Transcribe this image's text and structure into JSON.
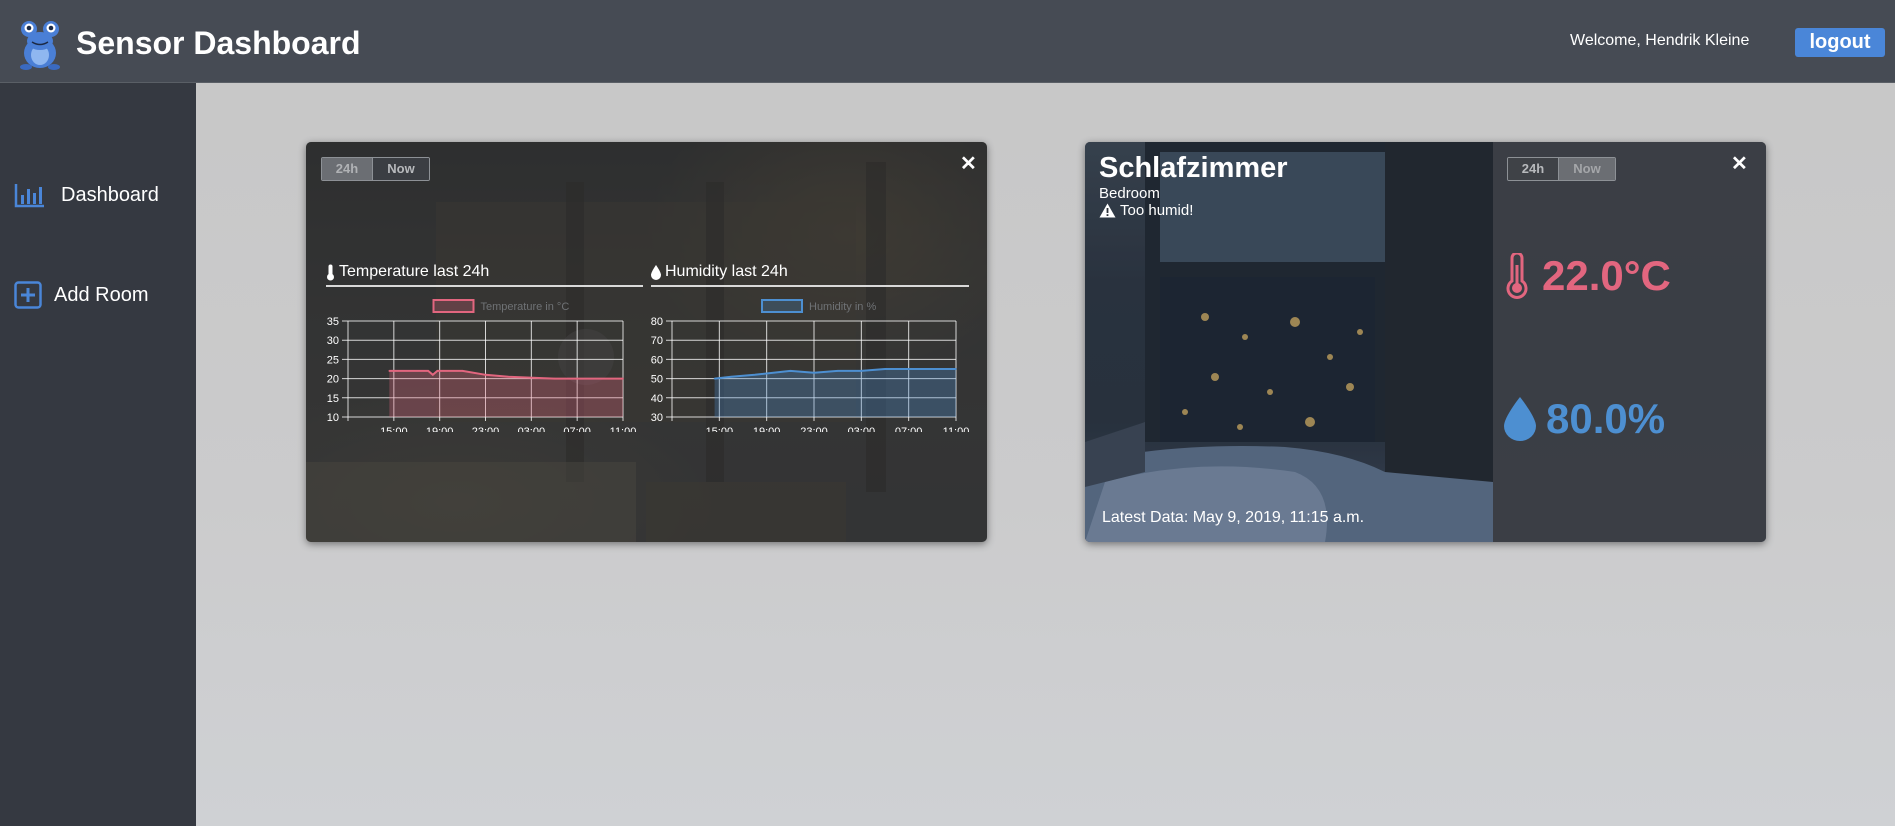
{
  "header": {
    "app_title": "Sensor Dashboard",
    "welcome": "Welcome, Hendrik Kleine",
    "logout_label": "logout",
    "logo_icon": "frog-logo-icon"
  },
  "sidebar": {
    "items": [
      {
        "label": "Dashboard",
        "icon": "bar-chart-icon"
      },
      {
        "label": "Add Room",
        "icon": "plus-square-icon"
      }
    ]
  },
  "cards": [
    {
      "toggle": {
        "option_a": "24h",
        "option_b": "Now",
        "selected": "24h"
      },
      "close_label": "✕",
      "charts": [
        {
          "heading": "Temperature last 24h",
          "icon": "thermometer-icon",
          "chart_data": {
            "type": "area",
            "legend": "Temperature in °C",
            "color": "#e2667f",
            "x_ticks": [
              "15:00",
              "19:00",
              "23:00",
              "03:00",
              "07:00",
              "11:00"
            ],
            "y_ticks": [
              35,
              30,
              25,
              20,
              15,
              10
            ],
            "ylim": [
              10,
              35
            ],
            "xlim": [
              0,
              24
            ],
            "x": [
              3.6,
              7.0,
              7.4,
              7.8,
              10.0,
              12.0,
              14.0,
              18.0,
              24.0
            ],
            "y": [
              22,
              22,
              21,
              22,
              22,
              21,
              20.5,
              20,
              20
            ]
          }
        },
        {
          "heading": "Humidity last 24h",
          "icon": "droplet-icon",
          "chart_data": {
            "type": "area",
            "legend": "Humidity in %",
            "color": "#4d8fd1",
            "x_ticks": [
              "15:00",
              "19:00",
              "23:00",
              "03:00",
              "07:00",
              "11:00"
            ],
            "y_ticks": [
              80,
              70,
              60,
              50,
              40,
              30
            ],
            "ylim": [
              30,
              80
            ],
            "xlim": [
              0,
              24
            ],
            "x": [
              3.6,
              5.0,
              7.0,
              10.0,
              12.0,
              14.0,
              16.0,
              18.0,
              20.0,
              22.0,
              24.0
            ],
            "y": [
              50,
              51,
              52,
              54,
              53,
              54,
              54,
              55,
              55,
              55,
              55
            ]
          }
        }
      ]
    },
    {
      "room_name": "Schlafzimmer",
      "room_type": "Bedroom",
      "warning": "Too humid!",
      "latest_data": "Latest Data: May 9, 2019, 11:15 a.m.",
      "toggle": {
        "option_a": "24h",
        "option_b": "Now",
        "selected": "Now"
      },
      "close_label": "✕",
      "temperature": "22.0°C",
      "humidity": "80.0%",
      "temp_color": "#e2667f",
      "hum_color": "#4d8fd1"
    }
  ]
}
